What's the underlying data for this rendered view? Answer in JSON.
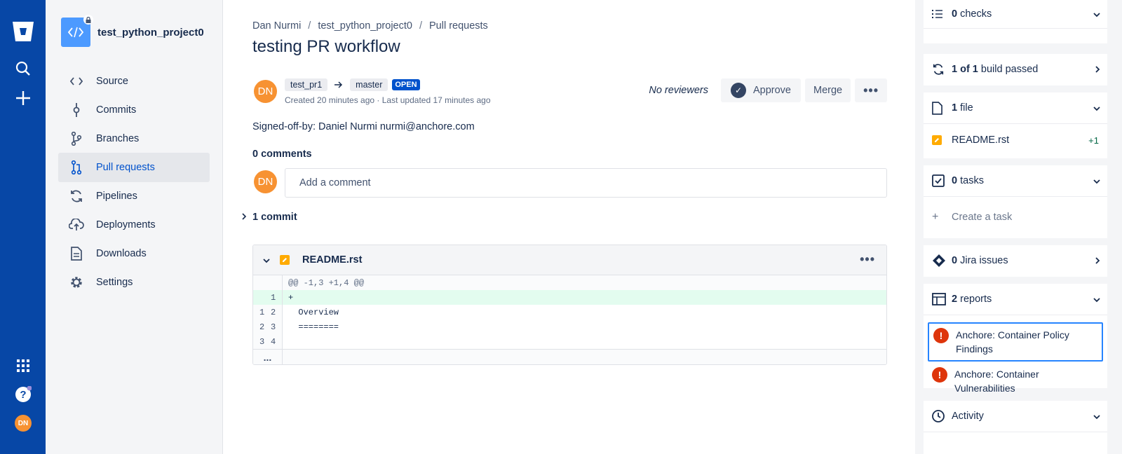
{
  "global_nav": {
    "avatar_initials": "DN"
  },
  "project": {
    "name": "test_python_project0"
  },
  "sidebar": {
    "items": [
      {
        "label": "Source",
        "icon": "code-icon"
      },
      {
        "label": "Commits",
        "icon": "commit-icon"
      },
      {
        "label": "Branches",
        "icon": "branch-icon"
      },
      {
        "label": "Pull requests",
        "icon": "pull-request-icon",
        "active": true
      },
      {
        "label": "Pipelines",
        "icon": "pipelines-icon"
      },
      {
        "label": "Deployments",
        "icon": "cloud-upload-icon"
      },
      {
        "label": "Downloads",
        "icon": "document-icon"
      },
      {
        "label": "Settings",
        "icon": "gear-icon"
      }
    ]
  },
  "breadcrumb": [
    "Dan Nurmi",
    "test_python_project0",
    "Pull requests"
  ],
  "pr": {
    "title": "testing PR workflow",
    "author_initials": "DN",
    "source_branch": "test_pr1",
    "target_branch": "master",
    "status": "OPEN",
    "created_text": "Created 20 minutes ago · Last updated 17 minutes ago",
    "no_reviewers": "No reviewers",
    "approve_label": "Approve",
    "merge_label": "Merge",
    "description": "Signed-off-by: Daniel Nurmi nurmi@anchore.com"
  },
  "comments": {
    "title": "0 comments",
    "placeholder": "Add a comment",
    "user_initials": "DN"
  },
  "commits_toggle": "1 commit",
  "diff": {
    "filename": "README.rst",
    "hunk": "@@ -1,3 +1,4 @@",
    "rows": [
      {
        "old": "",
        "new": "1",
        "code": "+",
        "type": "added"
      },
      {
        "old": "1",
        "new": "2",
        "code": "  Overview",
        "type": "context"
      },
      {
        "old": "2",
        "new": "3",
        "code": "  ========",
        "type": "context"
      },
      {
        "old": "3",
        "new": "4",
        "code": "",
        "type": "context"
      }
    ],
    "expand_label": "..."
  },
  "right_panel": {
    "checks": {
      "count": "0",
      "label": "checks"
    },
    "build": {
      "count": "1 of 1",
      "label": "build passed"
    },
    "files": {
      "count": "1",
      "label": "file",
      "file": "README.rst",
      "delta": "+1"
    },
    "tasks": {
      "count": "0",
      "label": "tasks",
      "create": "Create a task"
    },
    "jira": {
      "count": "0",
      "label": "Jira issues"
    },
    "reports": {
      "count": "2",
      "label": "reports",
      "items": [
        "Anchore: Container Policy Findings",
        "Anchore: Container Vulnerabilities"
      ]
    },
    "activity": {
      "label": "Activity"
    }
  },
  "colors": {
    "global_nav": "#0747a6",
    "accent": "#0052cc",
    "added_bg": "#e3fcef",
    "error": "#de350b",
    "avatar": "#f79232"
  }
}
